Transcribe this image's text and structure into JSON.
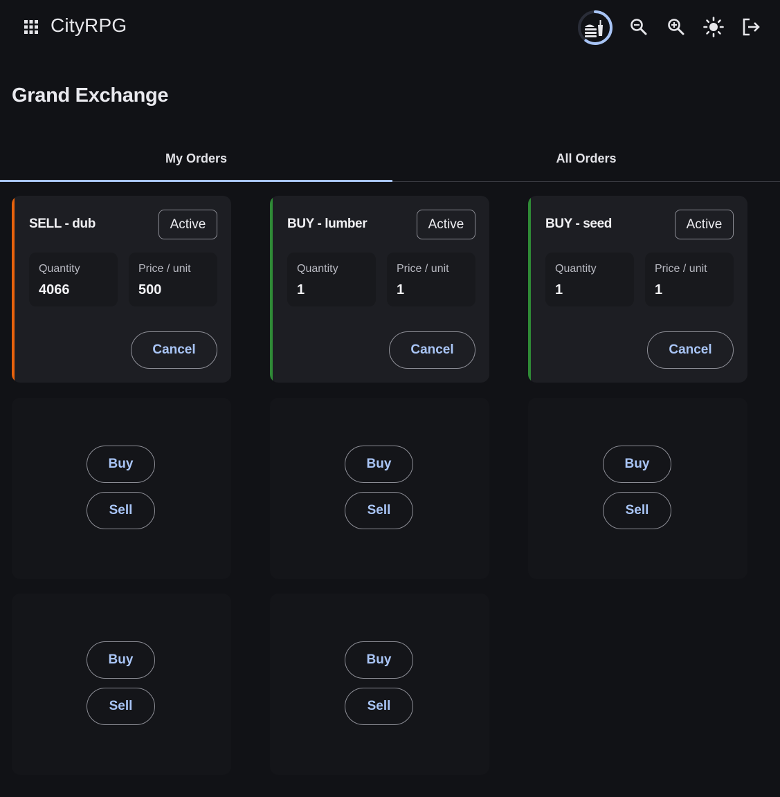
{
  "app": {
    "title": "CityRPG",
    "icons": [
      "apps-grid-icon",
      "cooldown-timer-icon",
      "zoom-out-icon",
      "zoom-in-icon",
      "brightness-icon",
      "logout-icon"
    ],
    "cooldown_progress": 0.6
  },
  "page": {
    "title": "Grand Exchange"
  },
  "tabs": [
    {
      "label": "My Orders",
      "active": true
    },
    {
      "label": "All Orders",
      "active": false
    }
  ],
  "orders": [
    {
      "title": "SELL - dub",
      "status": "Active",
      "quantity_label": "Quantity",
      "quantity": "4066",
      "price_label": "Price / unit",
      "price": "500",
      "cancel_label": "Cancel",
      "accent": "#e8620c"
    },
    {
      "title": "BUY - lumber",
      "status": "Active",
      "quantity_label": "Quantity",
      "quantity": "1",
      "price_label": "Price / unit",
      "price": "1",
      "cancel_label": "Cancel",
      "accent": "#2f8a36"
    },
    {
      "title": "BUY - seed",
      "status": "Active",
      "quantity_label": "Quantity",
      "quantity": "1",
      "price_label": "Price / unit",
      "price": "1",
      "cancel_label": "Cancel",
      "accent": "#2f8a36"
    }
  ],
  "empty_slots": [
    {
      "buy_label": "Buy",
      "sell_label": "Sell"
    },
    {
      "buy_label": "Buy",
      "sell_label": "Sell"
    },
    {
      "buy_label": "Buy",
      "sell_label": "Sell"
    },
    {
      "buy_label": "Buy",
      "sell_label": "Sell"
    },
    {
      "buy_label": "Buy",
      "sell_label": "Sell"
    }
  ],
  "colors": {
    "background": "#111216",
    "card": "#1d1e23",
    "accent_blue": "#a8c4f5",
    "sell_accent": "#e8620c",
    "buy_accent": "#2f8a36"
  }
}
